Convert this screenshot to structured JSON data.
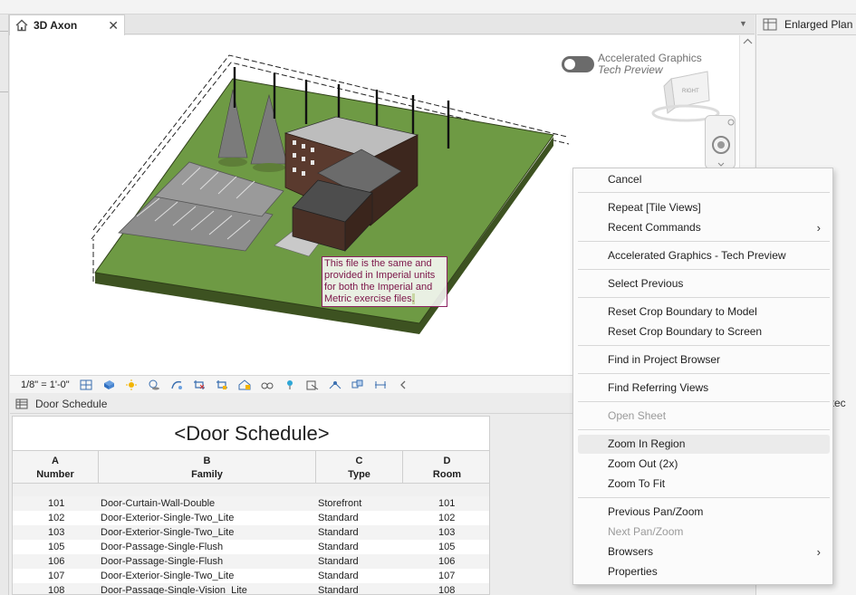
{
  "view_tab": {
    "title": "3D Axon",
    "close": "✕"
  },
  "right_tab": {
    "title": "Enlarged Plan"
  },
  "accelerated_graphics": {
    "line1": "Accelerated Graphics",
    "line2": "Tech Preview"
  },
  "viewcube": {
    "face_label": "RIGHT"
  },
  "text_note": {
    "line1": "This file is the same and",
    "line2": "provided in Imperial units",
    "line3": "for both the Imperial and",
    "line4": "Metric exercise files",
    "period": "."
  },
  "view_control_bar": {
    "scale": "1/8\" = 1'-0\""
  },
  "schedule_tab": {
    "title": "Door Schedule"
  },
  "schedule": {
    "title": "<Door Schedule>",
    "column_letters": [
      "A",
      "B",
      "C",
      "D"
    ],
    "column_names": [
      "Number",
      "Family",
      "Type",
      "Room"
    ],
    "rows": [
      [
        "101",
        "Door-Curtain-Wall-Double",
        "Storefront",
        "101"
      ],
      [
        "102",
        "Door-Exterior-Single-Two_Lite",
        "Standard",
        "102"
      ],
      [
        "103",
        "Door-Exterior-Single-Two_Lite",
        "Standard",
        "103"
      ],
      [
        "105",
        "Door-Passage-Single-Flush",
        "Standard",
        "105"
      ],
      [
        "106",
        "Door-Passage-Single-Flush",
        "Standard",
        "106"
      ],
      [
        "107",
        "Door-Exterior-Single-Two_Lite",
        "Standard",
        "107"
      ],
      [
        "108",
        "Door-Passage-Single-Vision_Lite",
        "Standard",
        "108"
      ]
    ]
  },
  "partial_right_text": "itec",
  "context_menu": {
    "items": [
      {
        "label": "Cancel",
        "enabled": true
      },
      {
        "label": "Repeat [Tile Views]",
        "enabled": true
      },
      {
        "label": "Recent Commands",
        "enabled": true,
        "submenu": true
      },
      {
        "label": "Accelerated Graphics - Tech Preview",
        "enabled": true
      },
      {
        "label": "Select Previous",
        "enabled": true
      },
      {
        "label": "Reset Crop Boundary to Model",
        "enabled": true
      },
      {
        "label": "Reset Crop Boundary to Screen",
        "enabled": true
      },
      {
        "label": "Find in Project Browser",
        "enabled": true
      },
      {
        "label": "Find Referring Views",
        "enabled": true
      },
      {
        "label": "Open Sheet",
        "enabled": false
      },
      {
        "label": "Zoom In Region",
        "enabled": true,
        "highlighted": true
      },
      {
        "label": "Zoom Out (2x)",
        "enabled": true
      },
      {
        "label": "Zoom To Fit",
        "enabled": true
      },
      {
        "label": "Previous Pan/Zoom",
        "enabled": true
      },
      {
        "label": "Next Pan/Zoom",
        "enabled": false
      },
      {
        "label": "Browsers",
        "enabled": true,
        "submenu": true
      },
      {
        "label": "Properties",
        "enabled": true
      }
    ],
    "submenu_arrow": "›"
  },
  "colors": {
    "ground": "#6e9a44",
    "ground_side": "#3d5221",
    "parking": "#8c8c8c",
    "building_brick": "#5a3a2e",
    "roof": "#4d4d4d",
    "note_border": "#8b2060",
    "note_text": "#7b1448"
  }
}
